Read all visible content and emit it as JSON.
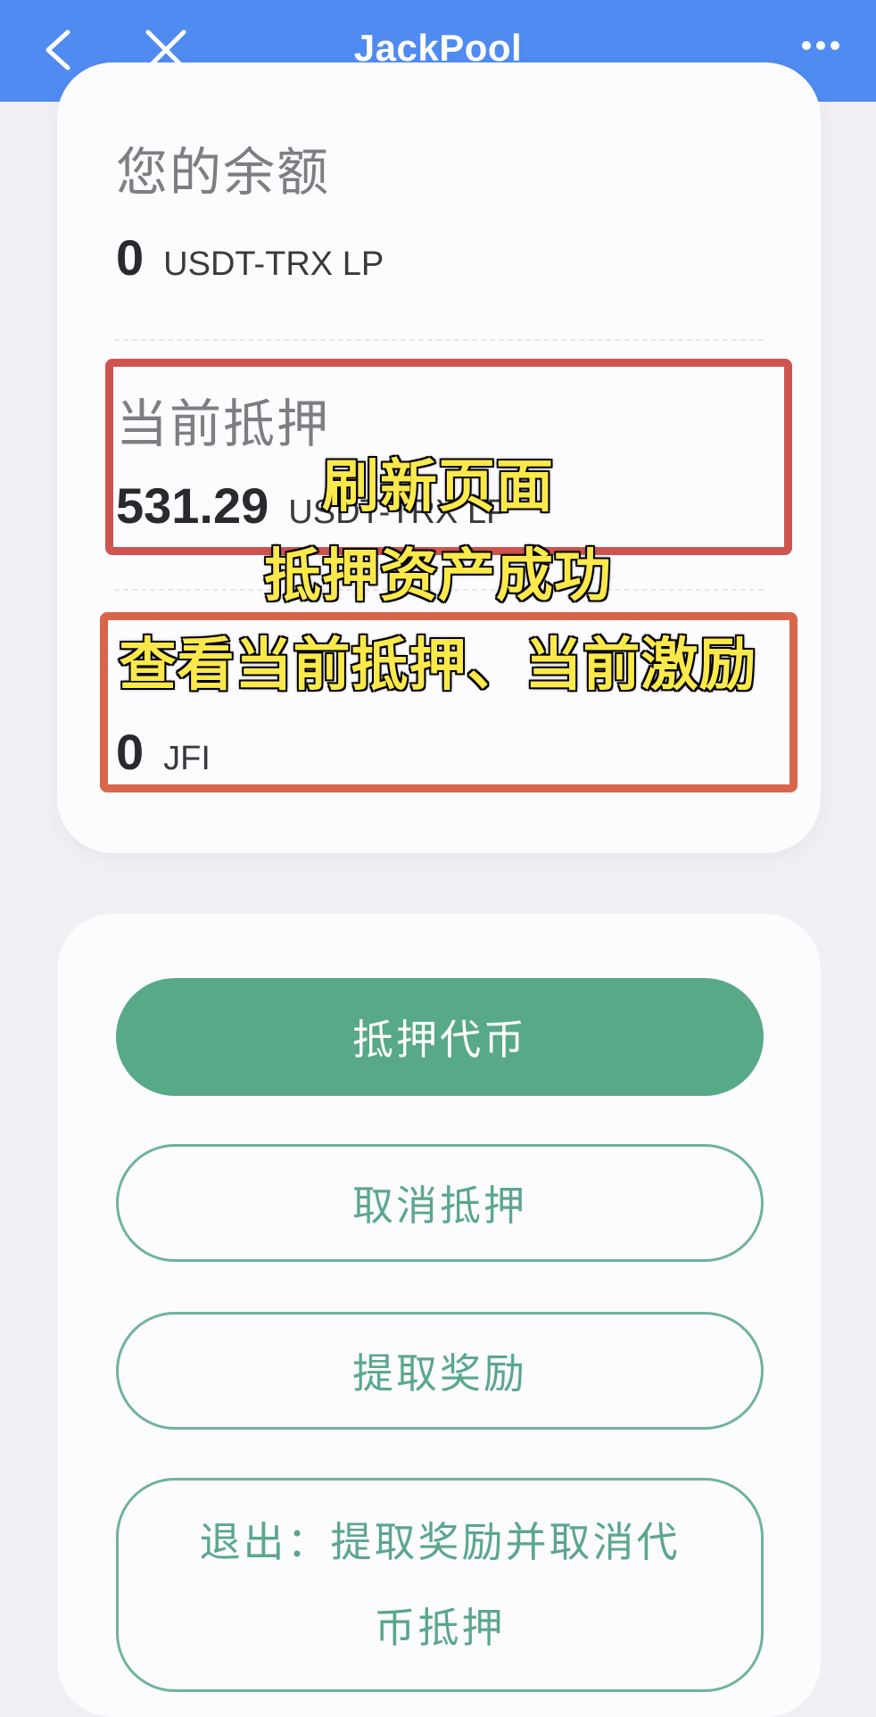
{
  "topbar": {
    "title": "JackPool",
    "back_icon": "chevron-left-icon",
    "close_icon": "close-icon",
    "more_icon": "more-horizontal-icon"
  },
  "balance": {
    "label": "您的余额",
    "amount": "0",
    "unit": "USDT-TRX LP"
  },
  "staked": {
    "label": "当前抵押",
    "amount": "531.29",
    "unit": "USDT-TRX LP"
  },
  "reward": {
    "amount": "0",
    "unit": "JFI"
  },
  "overlay": {
    "line1": "刷新页面",
    "line2": "抵押资产成功",
    "line3": "查看当前抵押、当前激励"
  },
  "buttons": {
    "stake": "抵押代币",
    "unstake": "取消抵押",
    "claim": "提取奖励",
    "exit": "退出：提取奖励并取消代币抵押"
  },
  "colors": {
    "topbar": "#4f8bf0",
    "primary_button": "#58a987",
    "highlight_red": "#cf5450",
    "highlight_orange": "#d8664b",
    "overlay_text": "#fbe94c"
  }
}
